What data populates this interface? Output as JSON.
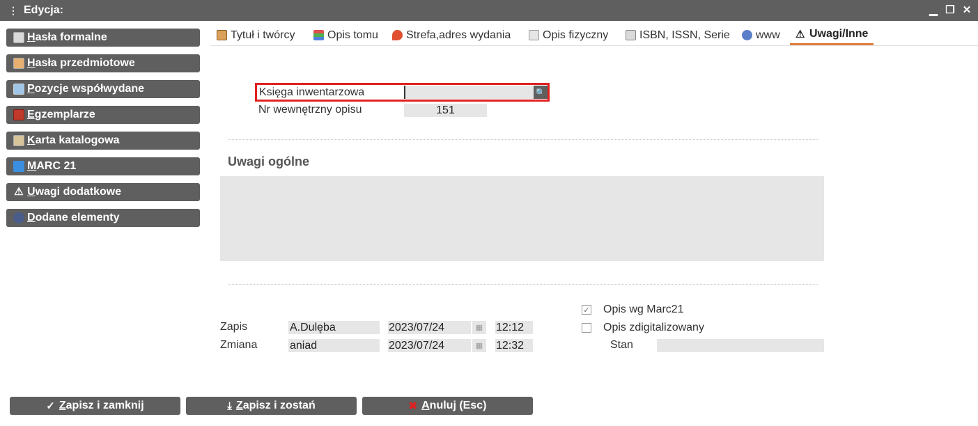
{
  "window": {
    "menu_glyph": "⋮",
    "title": "Edycja:",
    "min_glyph": "▁",
    "restore_glyph": "❐",
    "close_glyph": "✕"
  },
  "sidebar": {
    "items": [
      {
        "label": "Hasła formalne",
        "icon": "book-icon",
        "color": "#d9d9d9"
      },
      {
        "label": "Hasła przedmiotowe",
        "icon": "book-icon",
        "color": "#e8b070"
      },
      {
        "label": "Pozycje współwydane",
        "icon": "map-icon",
        "color": "#9fc6e8"
      },
      {
        "label": "Egzemplarze",
        "icon": "red-book-icon",
        "color": "#c0392b"
      },
      {
        "label": "Karta katalogowa",
        "icon": "card-icon",
        "color": "#d8c49b"
      },
      {
        "label": "MARC 21",
        "icon": "marc-icon",
        "color": "#3b8fe0"
      },
      {
        "label": "Uwagi dodatkowe",
        "icon": "warning-icon",
        "color": "#ffffff"
      },
      {
        "label": "Dodane elementy",
        "icon": "disc-icon",
        "color": "#4a5d8a"
      }
    ]
  },
  "tabs": [
    {
      "label": "Tytuł i twórcy",
      "icon": "book-icon"
    },
    {
      "label": "Opis tomu",
      "icon": "books-stack-icon"
    },
    {
      "label": "Strefa,adres wydania",
      "icon": "location-icon"
    },
    {
      "label": "Opis fizyczny",
      "icon": "document-icon"
    },
    {
      "label": "ISBN, ISSN, Serie",
      "icon": "book-icon"
    },
    {
      "label": "www",
      "icon": "globe-icon"
    },
    {
      "label": "Uwagi/Inne",
      "icon": "warning-icon"
    }
  ],
  "form": {
    "ksiega_label": "Księga inwentarzowa",
    "ksiega_value": "",
    "search_glyph": "🔍",
    "nr_label": "Nr wewnętrzny opisu",
    "nr_value": "151",
    "uwagi_title": "Uwagi ogólne",
    "uwagi_value": "",
    "zapis_label": "Zapis",
    "zapis_user": "A.Dulęba",
    "zapis_date": "2023/07/24",
    "zapis_time": "12:12",
    "zmiana_label": "Zmiana",
    "zmiana_user": "aniad",
    "zmiana_date": "2023/07/24",
    "zmiana_time": "12:32",
    "cal_glyph": "▦",
    "opis_marc_label": "Opis wg Marc21",
    "opis_marc_checked": true,
    "opis_dig_label": "Opis zdigitalizowany",
    "opis_dig_checked": false,
    "check_glyph": "✓",
    "stan_label": "Stan",
    "stan_value": ""
  },
  "buttons": {
    "save_close": "Zapisz i zamknij",
    "save_close_glyph": "✓",
    "save_stay": "Zapisz i zostań",
    "save_stay_glyph": "⤓",
    "cancel": "Anuluj (Esc)",
    "cancel_glyph": "✖"
  },
  "colors": {
    "accent_tab": "#e07b39",
    "highlight_border": "#e02020",
    "button_bg": "#5f5f5f",
    "cancel_icon": "#e02020"
  }
}
